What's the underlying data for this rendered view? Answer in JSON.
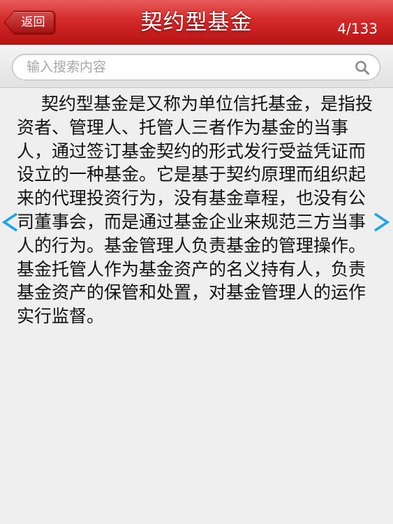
{
  "navbar": {
    "back_label": "返回",
    "title": "契约型基金",
    "counter": "4/133"
  },
  "search": {
    "placeholder": "输入搜索内容",
    "value": ""
  },
  "content": {
    "body": "契约型基金是又称为单位信托基金，是指投资者、管理人、托管人三者作为基金的当事人，通过签订基金契约的形式发行受益凭证而设立的一种基金。它是基于契约原理而组织起来的代理投资行为，没有基金章程，也没有公司董事会，而是通过基金企业来规范三方当事人的行为。基金管理人负责基金的管理操作。基金托管人作为基金资产的名义持有人，负责基金资产的保管和处置，对基金管理人的运作实行监督。"
  },
  "icons": {
    "back": "back-arrow-button",
    "search": "search-icon",
    "prev": "chevron-left-icon",
    "next": "chevron-right-icon"
  },
  "colors": {
    "navbar_red": "#d42a2a",
    "arrow_blue": "#1aa3e8",
    "background": "#efefef"
  }
}
